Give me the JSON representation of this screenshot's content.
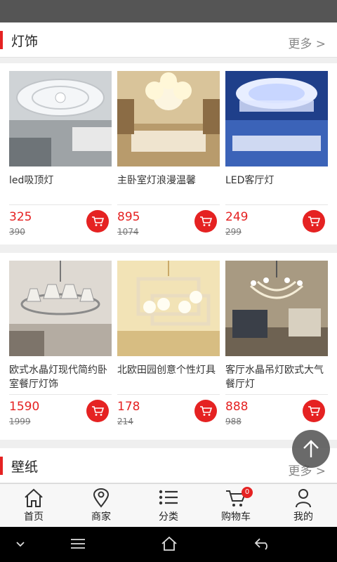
{
  "sections": {
    "lighting": {
      "title": "灯饰",
      "more": "更多 >"
    },
    "wallpaper": {
      "title": "壁纸",
      "more": "更多 >"
    }
  },
  "products": [
    {
      "name": "led吸顶灯",
      "price": "325",
      "old_price": "390"
    },
    {
      "name": "主卧室灯浪漫温馨",
      "price": "895",
      "old_price": "1074"
    },
    {
      "name": "LED客厅灯",
      "price": "249",
      "old_price": "299"
    },
    {
      "name": "欧式水晶灯现代简约卧室餐厅灯饰",
      "price": "1590",
      "old_price": "1999"
    },
    {
      "name": "北欧田园创意个性灯具",
      "price": "178",
      "old_price": "214"
    },
    {
      "name": "客厅水晶吊灯欧式大气餐厅灯",
      "price": "888",
      "old_price": "988"
    }
  ],
  "tab_bar": {
    "home": "首页",
    "merchants": "商家",
    "categories": "分类",
    "cart": "购物车",
    "cart_badge": "0",
    "mine": "我的"
  },
  "colors": {
    "accent": "#e52222"
  }
}
